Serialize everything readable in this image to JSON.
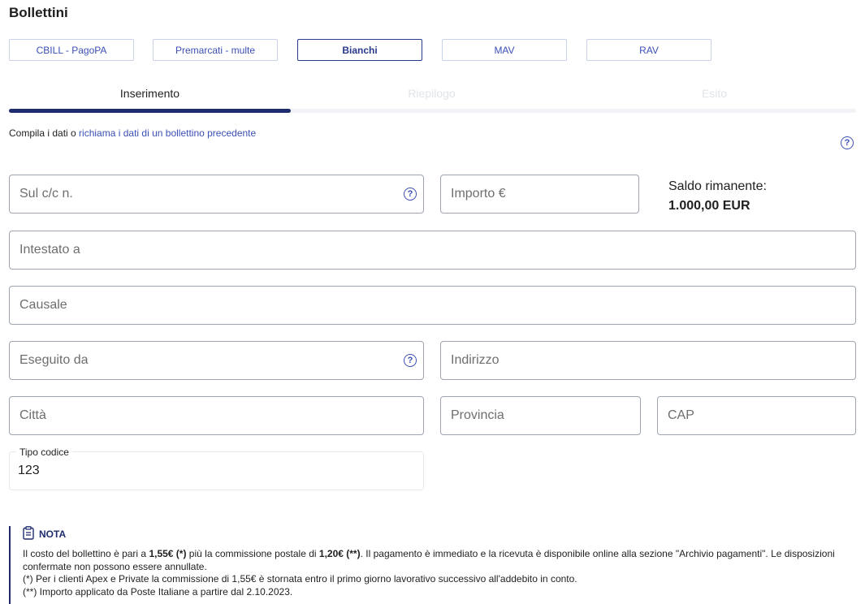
{
  "page": {
    "title": "Bollettini"
  },
  "bill_types": [
    {
      "label": "CBILL - PagoPA"
    },
    {
      "label": "Premarcati - multe"
    },
    {
      "label": "Bianchi"
    },
    {
      "label": "MAV"
    },
    {
      "label": "RAV"
    }
  ],
  "active_bill_type": "Bianchi",
  "steps": [
    {
      "label": "Inserimento",
      "state": "active"
    },
    {
      "label": "Riepilogo",
      "state": "inactive"
    },
    {
      "label": "Esito",
      "state": "inactive"
    }
  ],
  "hint": {
    "prefix": "Compila i dati o ",
    "link": "richiama i dati di un bollettino precedente"
  },
  "form": {
    "conto": {
      "placeholder": "Sul c/c n.",
      "value": ""
    },
    "importo": {
      "placeholder": "Importo €",
      "value": ""
    },
    "intestato": {
      "placeholder": "Intestato a",
      "value": ""
    },
    "causale": {
      "placeholder": "Causale",
      "value": ""
    },
    "eseguito": {
      "placeholder": "Eseguito da",
      "value": ""
    },
    "indirizzo": {
      "placeholder": "Indirizzo",
      "value": ""
    },
    "citta": {
      "placeholder": "Città",
      "value": ""
    },
    "provincia": {
      "placeholder": "Provincia",
      "value": ""
    },
    "cap": {
      "placeholder": "CAP",
      "value": ""
    },
    "tipo_codice": {
      "label": "Tipo codice",
      "value": "123"
    }
  },
  "saldo": {
    "label": "Saldo rimanente:",
    "value": "1.000,00 EUR"
  },
  "note": {
    "title": "NOTA",
    "line1_a": "Il costo del bollettino è pari a ",
    "line1_b": "1,55€ (*)",
    "line1_c": " più la commissione postale di ",
    "line1_d": "1,20€ (**)",
    "line1_e": ". Il pagamento è immediato e la ricevuta è disponibile online alla sezione \"Archivio pagamenti\". Le disposizioni confermate non possono essere annullate.",
    "line2": "(*) Per i clienti Apex e Private la commissione di 1,55€ è stornata entro il primo giorno lavorativo successivo all'addebito in conto.",
    "line3": "(**) Importo applicato da Poste Italiane a partire dal 2.10.2023."
  },
  "icons": {
    "help": "help-circle-icon",
    "note": "clipboard-icon"
  },
  "colors": {
    "accent": "#3b4fb5",
    "primary_dark": "#1f2d6e",
    "border": "#9ea4b0"
  }
}
